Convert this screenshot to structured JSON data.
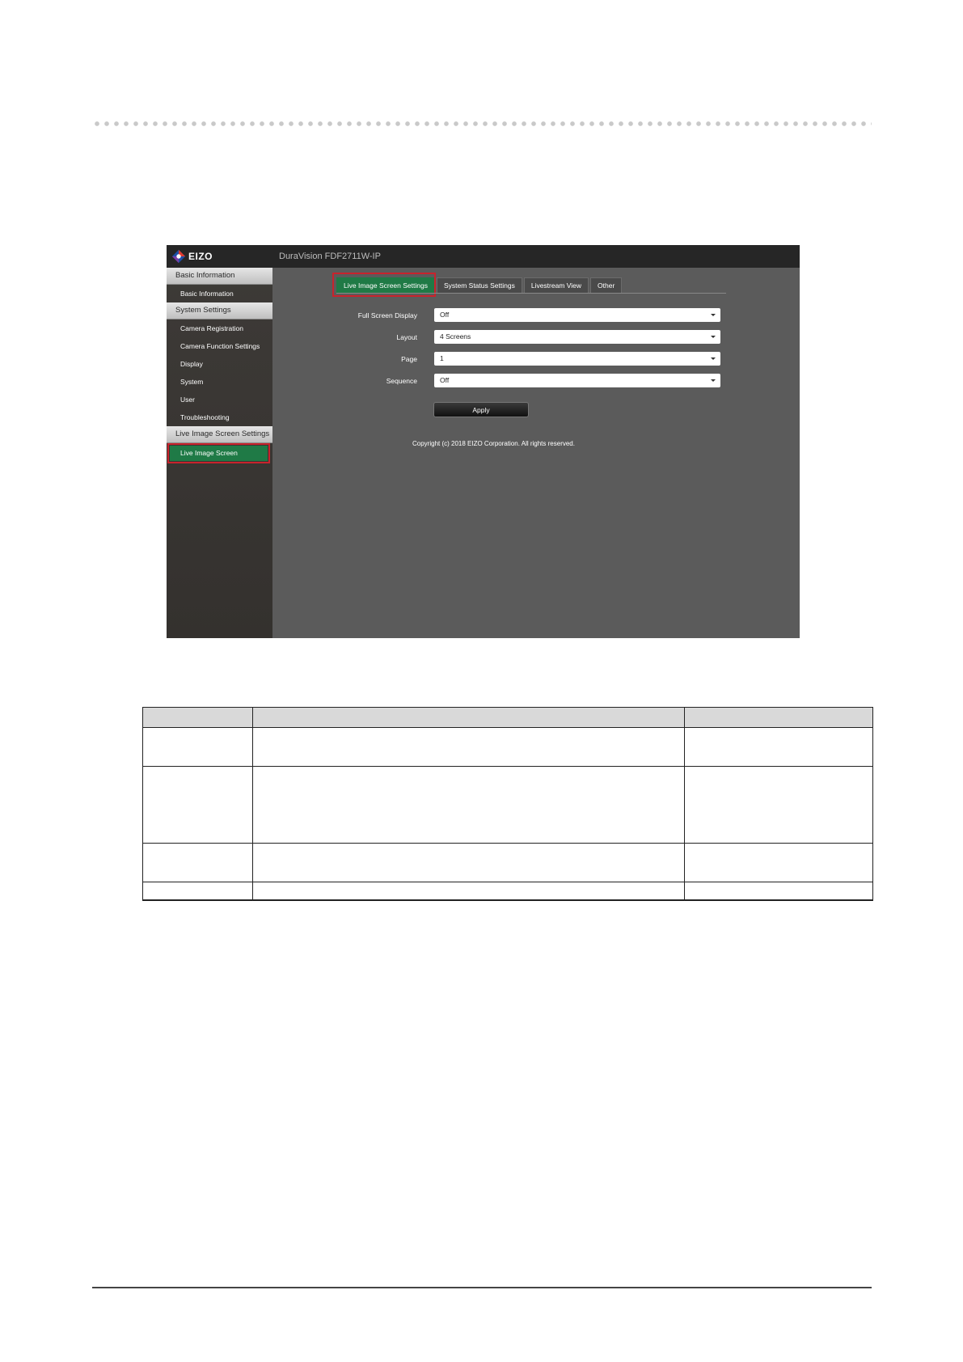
{
  "app": {
    "brand": "EIZO",
    "model": "DuraVision FDF2711W-IP"
  },
  "sidebar": {
    "sections": [
      {
        "heading": "Basic Information",
        "items": [
          "Basic Information"
        ]
      },
      {
        "heading": "System Settings",
        "items": [
          "Camera Registration",
          "Camera Function Settings",
          "Display",
          "System",
          "User",
          "Troubleshooting"
        ]
      },
      {
        "heading": "Live Image Screen Settings",
        "items": []
      }
    ],
    "active_item": "Live Image Screen"
  },
  "tabs": [
    "Live Image Screen Settings",
    "System Status Settings",
    "Livestream View",
    "Other"
  ],
  "form": {
    "fields": [
      {
        "label": "Full Screen Display",
        "value": "Off"
      },
      {
        "label": "Layout",
        "value": "4 Screens"
      },
      {
        "label": "Page",
        "value": "1"
      },
      {
        "label": "Sequence",
        "value": "Off"
      }
    ],
    "apply_label": "Apply"
  },
  "footer": {
    "copyright": "Copyright (c) 2018 EIZO Corporation. All rights reserved."
  },
  "colors": {
    "accent_green": "#1f7a46",
    "highlight_red": "#c8232c",
    "topbar": "#262626"
  }
}
